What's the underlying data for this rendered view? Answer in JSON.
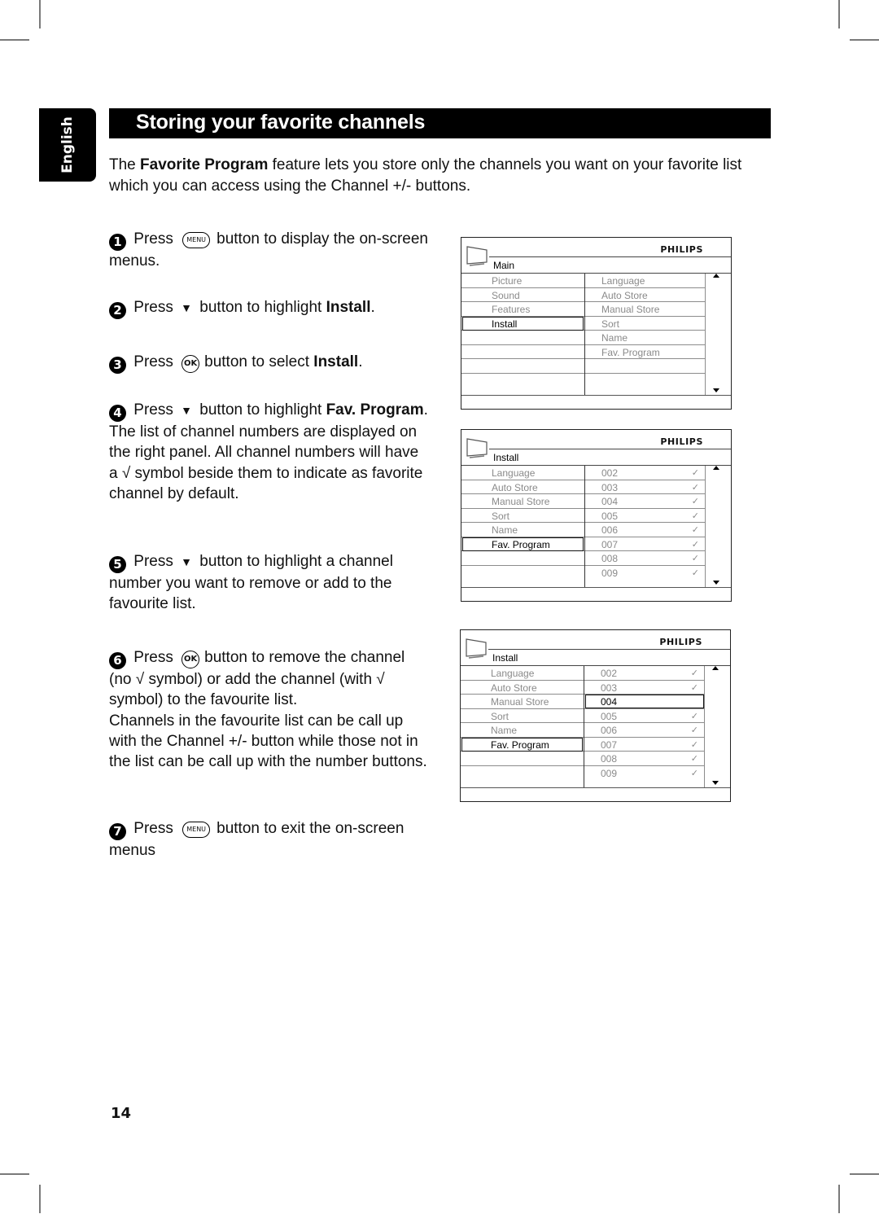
{
  "language_tab": "English",
  "title": "Storing your favorite channels",
  "intro": {
    "pre": "The ",
    "bold": "Favorite Program",
    "post": " feature lets you store only the channels you want on your favorite list which you can access using the Channel +/- buttons."
  },
  "buttons": {
    "menu": "MENU",
    "ok": "OK",
    "down": "▼"
  },
  "steps": [
    {
      "num": "1",
      "a": "Press",
      "b": "button to display the on-screen menus."
    },
    {
      "num": "2",
      "a": "Press",
      "b": "button to highlight ",
      "bold": "Install",
      "c": "."
    },
    {
      "num": "3",
      "a": "Press",
      "b": "button to select ",
      "bold": "Install",
      "c": "."
    },
    {
      "num": "4",
      "a": "Press",
      "b": "button to highlight ",
      "bold": "Fav. Program",
      "c": ".",
      "extra": "The list of channel numbers are displayed on the right panel. All channel numbers will have a √ symbol beside them to indicate as favorite channel by default."
    },
    {
      "num": "5",
      "a": "Press",
      "b": "button to highlight a channel number you want to remove or add to the favourite list."
    },
    {
      "num": "6",
      "a": "Press",
      "b": "button to remove the channel (no √ symbol) or add the channel (with √ symbol) to the favourite list.",
      "extra": "Channels in the favourite list can be call up with the Channel +/- button while those not in the list can be call up with the number buttons."
    },
    {
      "num": "7",
      "a": "Press",
      "b": "button to exit the on-screen menus"
    }
  ],
  "screens": [
    {
      "brand": "PHILIPS",
      "crumb": "Main",
      "left": [
        "Picture",
        "Sound",
        "Features",
        "Install",
        "",
        "",
        "",
        ""
      ],
      "left_selected": 3,
      "right": [
        "Language",
        "Auto Store",
        "Manual Store",
        "Sort",
        "Name",
        "Fav. Program",
        "",
        ""
      ],
      "right_checks": [
        false,
        false,
        false,
        false,
        false,
        false,
        false,
        false
      ],
      "right_selected": -1
    },
    {
      "brand": "PHILIPS",
      "crumb": "Install",
      "left": [
        "Language",
        "Auto Store",
        "Manual Store",
        "Sort",
        "Name",
        "Fav. Program",
        "",
        ""
      ],
      "left_selected": 5,
      "right": [
        "002",
        "003",
        "004",
        "005",
        "006",
        "007",
        "008",
        "009"
      ],
      "right_checks": [
        true,
        true,
        true,
        true,
        true,
        true,
        true,
        true
      ],
      "right_selected": -1
    },
    {
      "brand": "PHILIPS",
      "crumb": "Install",
      "left": [
        "Language",
        "Auto Store",
        "Manual Store",
        "Sort",
        "Name",
        "Fav. Program",
        "",
        ""
      ],
      "left_selected": 5,
      "right": [
        "002",
        "003",
        "004",
        "005",
        "006",
        "007",
        "008",
        "009"
      ],
      "right_checks": [
        true,
        true,
        false,
        true,
        true,
        true,
        true,
        true
      ],
      "right_selected": 2
    }
  ],
  "check_glyph": "✓",
  "page_number": "14"
}
